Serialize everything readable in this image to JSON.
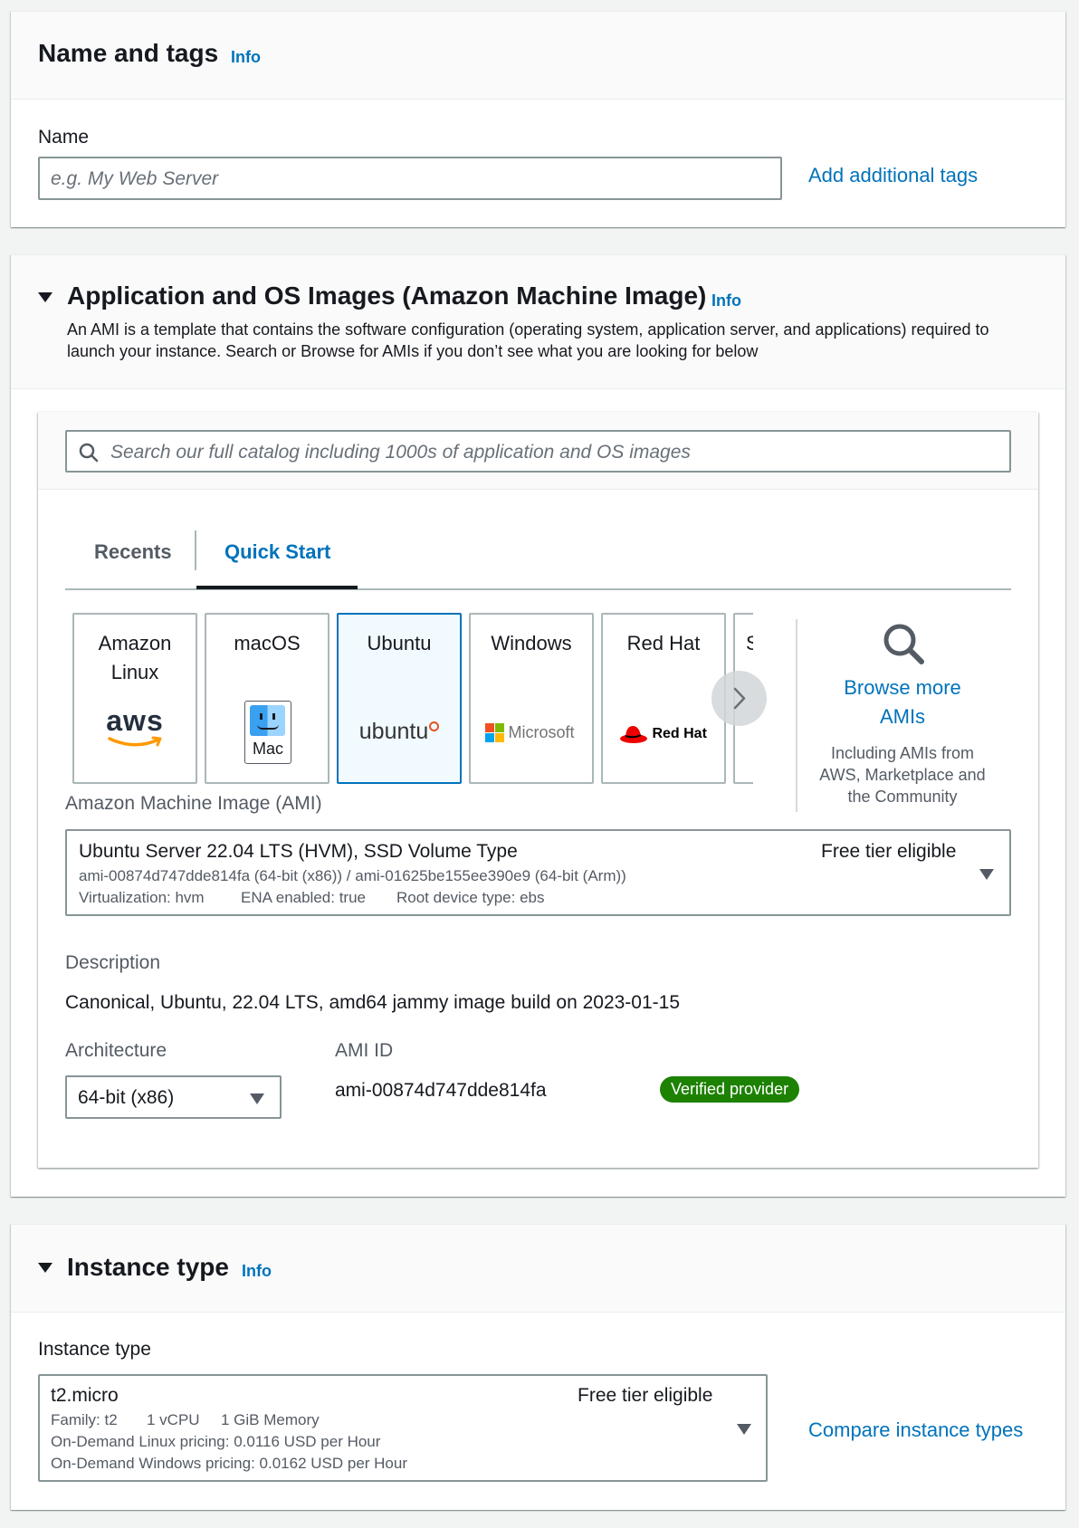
{
  "name_tags": {
    "title": "Name and tags",
    "info": "Info",
    "name_label": "Name",
    "name_placeholder": "e.g. My Web Server",
    "add_tags": "Add additional tags"
  },
  "ami_section": {
    "title": "Application and OS Images (Amazon Machine Image)",
    "info": "Info",
    "desc_line1": "An AMI is a template that contains the software configuration (operating system, application server, and applications) required to",
    "desc_line2": "launch your instance. Search or Browse for AMIs if you don’t see what you are looking for below",
    "search_placeholder": "Search our full catalog including 1000s of application and OS images",
    "tabs": [
      "Recents",
      "Quick Start"
    ],
    "selected_tab": "Quick Start",
    "os_tiles": [
      {
        "name_line1": "Amazon",
        "name_line2": "Linux",
        "logo": "aws"
      },
      {
        "name_line1": "macOS",
        "name_line2": "",
        "logo": "Mac"
      },
      {
        "name_line1": "Ubuntu",
        "name_line2": "",
        "logo": "ubuntu"
      },
      {
        "name_line1": "Windows",
        "name_line2": "",
        "logo": "Microsoft"
      },
      {
        "name_line1": "Red Hat",
        "name_line2": "",
        "logo": "Red Hat"
      },
      {
        "name_line1": "S",
        "name_line2": "",
        "logo": ""
      }
    ],
    "selected_os": "Ubuntu",
    "browse_more_line1": "Browse more",
    "browse_more_line2": "AMIs",
    "browse_sub_line1": "Including AMIs from",
    "browse_sub_line2": "AWS, Marketplace and",
    "browse_sub_line3": "the Community",
    "ami_label": "Amazon Machine Image (AMI)",
    "ami_select": {
      "name": "Ubuntu Server 22.04 LTS (HVM), SSD Volume Type",
      "free_tier": "Free tier eligible",
      "ids": "ami-00874d747dde814fa (64-bit (x86)) / ami-01625be155ee390e9 (64-bit (Arm))",
      "virtualization": "Virtualization: hvm",
      "ena": "ENA enabled: true",
      "root_device": "Root device type: ebs"
    },
    "description_label": "Description",
    "description": "Canonical, Ubuntu, 22.04 LTS, amd64 jammy image build on 2023-01-15",
    "architecture_label": "Architecture",
    "architecture_value": "64-bit (x86)",
    "ami_id_label": "AMI ID",
    "ami_id_value": "ami-00874d747dde814fa",
    "verified_badge": "Verified provider"
  },
  "instance_type": {
    "title": "Instance type",
    "info": "Info",
    "label": "Instance type",
    "value": "t2.micro",
    "free_tier": "Free tier eligible",
    "family": "Family: t2",
    "vcpu": "1 vCPU",
    "memory": "1 GiB Memory",
    "linux_pricing": "On-Demand Linux pricing: 0.0116 USD per Hour",
    "windows_pricing": "On-Demand Windows pricing: 0.0162 USD per Hour",
    "compare_link": "Compare instance types"
  },
  "colors": {
    "link": "#0073bb",
    "selected_tile_bg": "#f1faff",
    "badge_green": "#1d8102"
  }
}
